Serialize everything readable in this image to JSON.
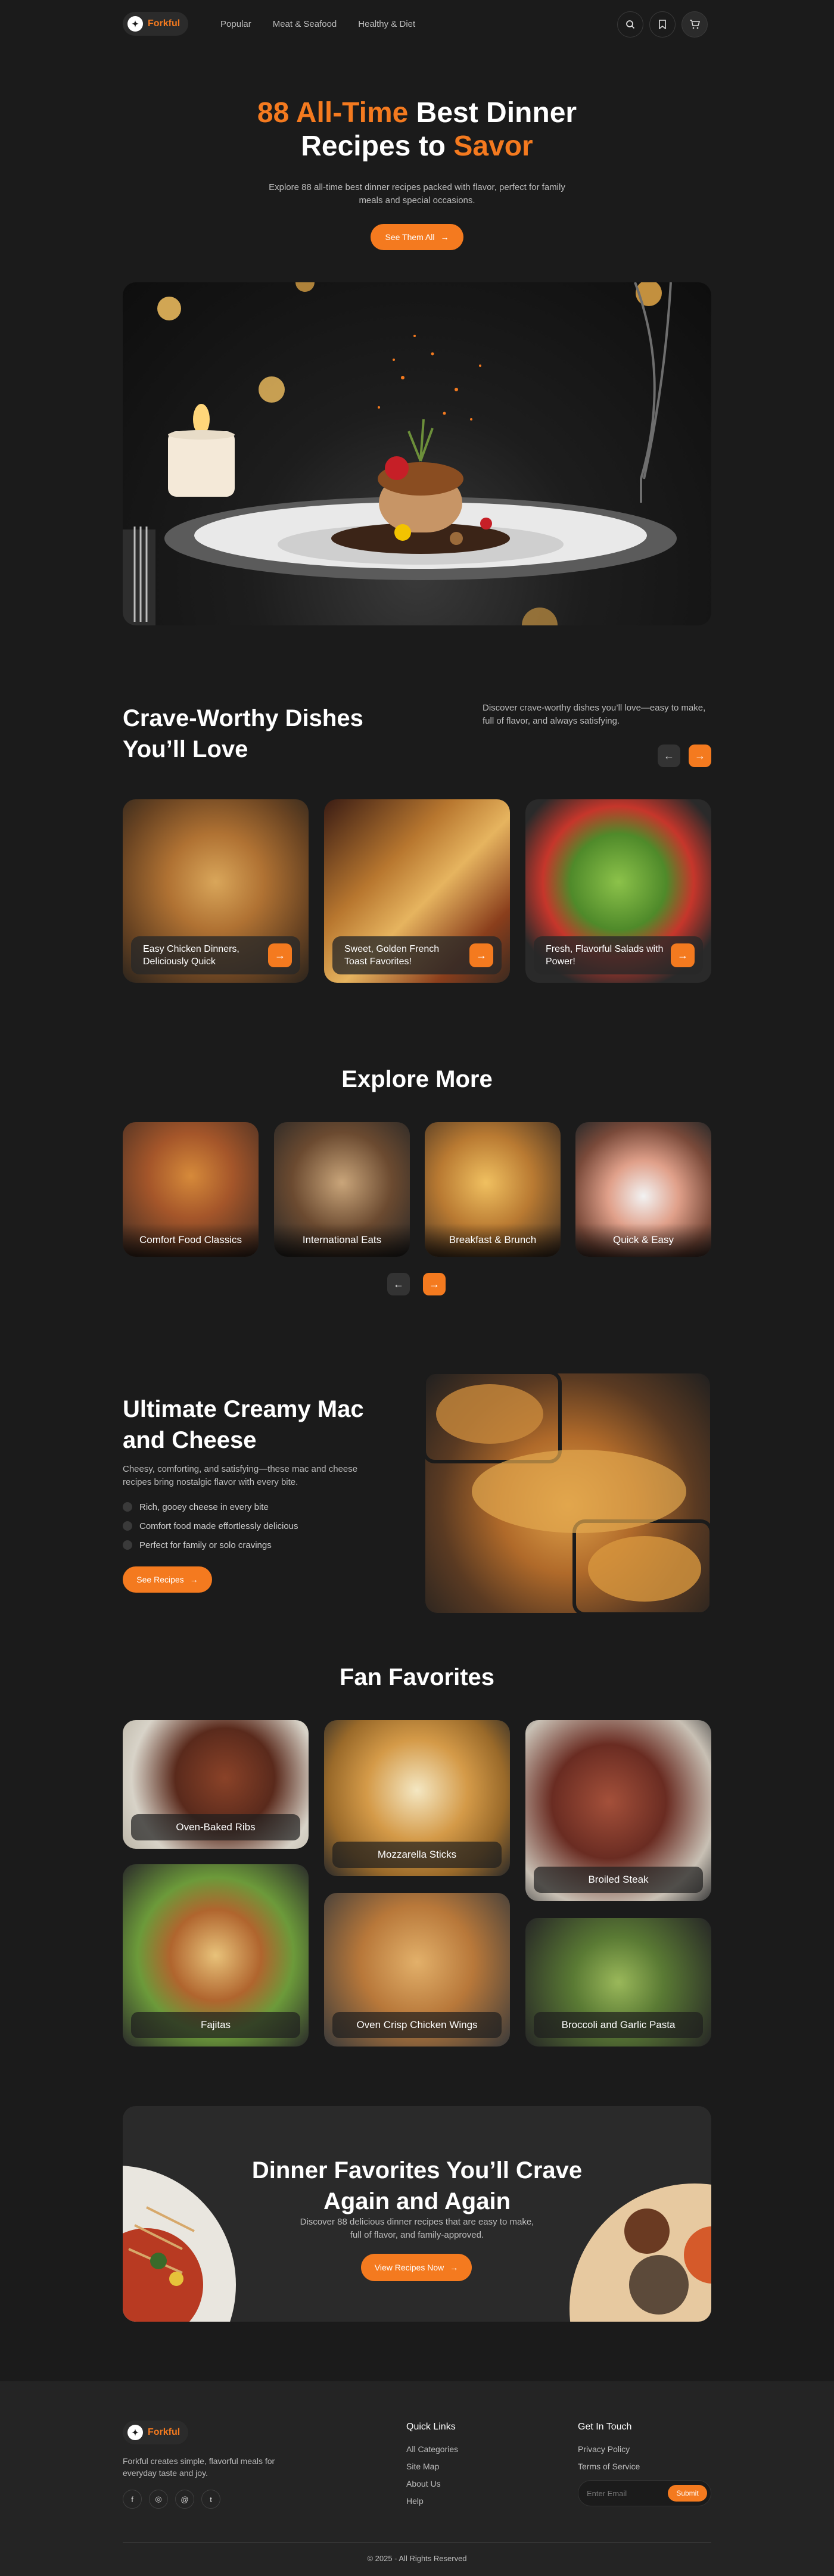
{
  "nav": {
    "brand": "Forkful",
    "links": [
      "Popular",
      "Meat & Seafood",
      "Healthy & Diet"
    ],
    "icons": [
      "search-icon",
      "bookmark-icon",
      "cart-icon"
    ]
  },
  "hero": {
    "title_a": "88 All-Time",
    "title_b": " Best Dinner",
    "title_c": "Recipes to ",
    "title_d": "Savor",
    "subtitle": "Explore 88 all-time best dinner recipes packed with flavor, perfect for family meals and special occasions.",
    "button": "See Them All"
  },
  "crave": {
    "title": "Crave-Worthy Dishes You’ll Love",
    "subtitle": "Discover crave-worthy dishes you’ll love—easy to make, full of flavor, and always satisfying.",
    "cards": [
      {
        "label": "Easy Chicken Dinners, Deliciously Quick"
      },
      {
        "label": "Sweet, Golden French Toast Favorites!"
      },
      {
        "label": "Fresh, Flavorful Salads with Power!"
      }
    ]
  },
  "explore": {
    "title": "Explore More",
    "categories": [
      "Comfort Food Classics",
      "International Eats",
      "Breakfast & Brunch",
      "Quick & Easy"
    ]
  },
  "mac": {
    "title": "Ultimate Creamy Mac and Cheese",
    "subtitle": "Cheesy, comforting, and satisfying—these mac and cheese recipes bring nostalgic flavor with every bite.",
    "points": [
      "Rich, gooey cheese in every bite",
      "Comfort food made effortlessly delicious",
      "Perfect for family or solo cravings"
    ],
    "button": "See Recipes"
  },
  "fans": {
    "title": "Fan Favorites",
    "items": [
      "Oven-Baked Ribs",
      "Mozzarella Sticks",
      "Broiled Steak",
      "Fajitas",
      "Oven Crisp Chicken Wings",
      "Broccoli and Garlic Pasta"
    ]
  },
  "cta": {
    "title": "Dinner Favorites You’ll Crave Again and Again",
    "subtitle": "Discover 88 delicious dinner recipes that are easy to make, full of flavor, and family-approved.",
    "button": "View Recipes Now"
  },
  "footer": {
    "brand": "Forkful",
    "tagline": "Forkful creates simple, flavorful meals for everyday taste and joy.",
    "quick_title": "Quick Links",
    "quick_links": [
      "All Categories",
      "Site Map",
      "About Us",
      "Help"
    ],
    "touch_title": "Get In Touch",
    "touch_links": [
      "Privacy Policy",
      "Terms of Service"
    ],
    "email_placeholder": "Enter Email",
    "submit": "Submit",
    "copyright": "© 2025 - All Rights Reserved"
  },
  "colors": {
    "accent": "#f47a1f",
    "background": "#1b1b1b",
    "card": "#2a2a2a"
  }
}
